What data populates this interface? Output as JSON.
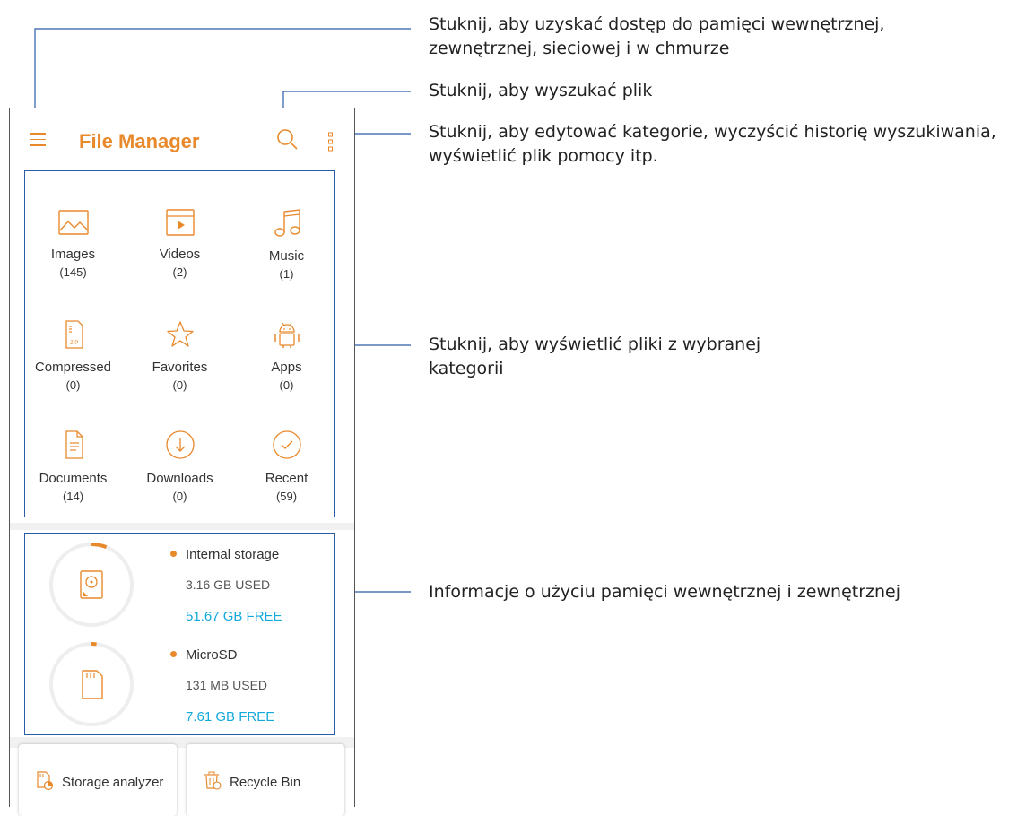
{
  "app": {
    "title": "File Manager"
  },
  "callouts": {
    "menu": [
      "Stuknij, aby uzyskać dostęp do pamięci wewnętrznej,",
      "zewnętrznej, sieciowej i w chmurze"
    ],
    "search": [
      "Stuknij, aby wyszukać plik"
    ],
    "more": [
      "Stuknij, aby edytować kategorie, wyczyścić historię wyszukiwania,",
      "wyświetlić plik pomocy itp."
    ],
    "categories": [
      "Stuknij, aby wyświetlić pliki z wybranej",
      "kategorii"
    ],
    "storage": [
      "Informacje o użyciu pamięci wewnętrznej i zewnętrznej"
    ]
  },
  "categories": [
    {
      "label": "Images",
      "count": "(145)",
      "icon": "image-icon"
    },
    {
      "label": "Videos",
      "count": "(2)",
      "icon": "video-icon"
    },
    {
      "label": "Music",
      "count": "(1)",
      "icon": "music-icon"
    },
    {
      "label": "Compressed",
      "count": "(0)",
      "icon": "zip-icon"
    },
    {
      "label": "Favorites",
      "count": "(0)",
      "icon": "star-icon"
    },
    {
      "label": "Apps",
      "count": "(0)",
      "icon": "android-icon"
    },
    {
      "label": "Documents",
      "count": "(14)",
      "icon": "document-icon"
    },
    {
      "label": "Downloads",
      "count": "(0)",
      "icon": "download-icon"
    },
    {
      "label": "Recent",
      "count": "(59)",
      "icon": "recent-check-icon"
    }
  ],
  "storage": [
    {
      "name": "Internal storage",
      "used": "3.16 GB USED",
      "free": "51.67 GB FREE",
      "used_fraction": 0.06,
      "icon": "hard-drive-icon"
    },
    {
      "name": "MicroSD",
      "used": "131 MB USED",
      "free": "7.61 GB FREE",
      "used_fraction": 0.02,
      "icon": "sd-card-icon"
    }
  ],
  "bottom": {
    "analyzer": "Storage analyzer",
    "recycle": "Recycle Bin"
  },
  "colors": {
    "accent": "#e8892c",
    "free": "#12a9dc",
    "callout_line": "#2a5ca8"
  }
}
